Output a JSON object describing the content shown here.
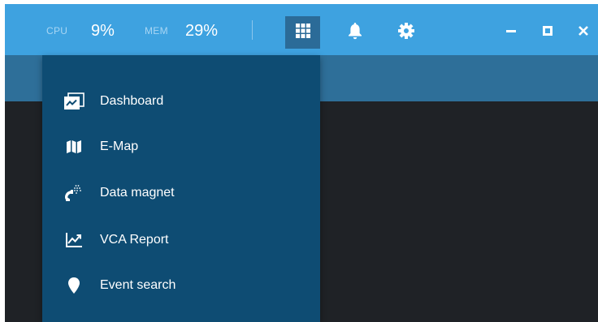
{
  "topbar": {
    "cpu_label": "CPU",
    "cpu_value": "9%",
    "mem_label": "MEM",
    "mem_value": "29%",
    "icons": [
      "apps-grid-icon",
      "bell-icon",
      "gear-icon",
      "minimize-icon",
      "maximize-icon",
      "close-icon"
    ]
  },
  "menu": {
    "items": [
      {
        "label": "Dashboard",
        "icon": "dashboard-icon"
      },
      {
        "label": "E-Map",
        "icon": "map-icon"
      },
      {
        "label": "Data magnet",
        "icon": "magnet-icon"
      },
      {
        "label": "VCA Report",
        "icon": "chart-icon"
      },
      {
        "label": "Event search",
        "icon": "location-pin-icon"
      }
    ]
  },
  "colors": {
    "topbar": "#3ea2e0",
    "subbar": "#2e6f99",
    "menu": "#0e4c73",
    "content": "#1f2226",
    "text": "#ffffff"
  }
}
